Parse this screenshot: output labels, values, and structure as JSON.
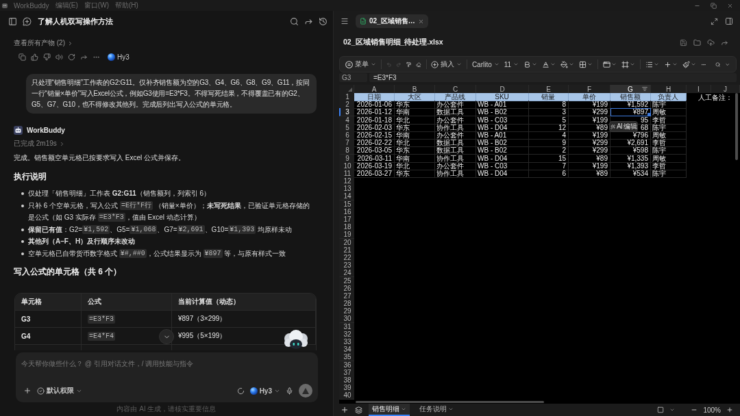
{
  "menu_bar": {
    "app_name": "WorkBuddy",
    "menus": [
      "编辑(E)",
      "窗口(W)",
      "帮助(H)"
    ]
  },
  "chat": {
    "title": "了解人机双写操作方法",
    "artifacts_link": "查看所有产物 (2)",
    "model_badge": "Hy3",
    "user_message": "只处理“销售明细”工作表的G2:G11。仅补齐销售额为空的G3、G4、G6、G8、G9、G11，按同一行“销量×单价”写入Excel公式，例如G3使用=E3*F3。不得写死结果，不得覆盖已有的G2、G5、G7、G10，也不得修改其他列。完成后列出写入公式的单元格。",
    "assistant_name": "WorkBuddy",
    "status": "已完成 2m19s",
    "summary": "完成。销售额空单元格已按要求写入 Excel 公式并保存。",
    "instructions": {
      "heading": "执行说明",
      "bullets": [
        {
          "bold": false,
          "parts": [
            {
              "kind": "text",
              "text": "仅处理「销售明细」工作表 **G2:G11**（销售额列，列索引 6）"
            }
          ]
        },
        {
          "bold": false,
          "parts": [
            {
              "kind": "text",
              "text": "只补 6 个空单元格，写入公式 "
            },
            {
              "kind": "code",
              "text": "=E行*F行"
            },
            {
              "kind": "text",
              "text": " （销量×单价）；**未写死结果**，已验证单元格存储的是公式（如 G3 实际存 "
            },
            {
              "kind": "code",
              "text": "=E3*F3"
            },
            {
              "kind": "text",
              "text": "，值由 Excel 动态计算）"
            }
          ]
        },
        {
          "bold": false,
          "parts": [
            {
              "kind": "text",
              "text": "**保留已有值**：G2="
            },
            {
              "kind": "code",
              "text": "¥1,592"
            },
            {
              "kind": "text",
              "text": "、G5="
            },
            {
              "kind": "code",
              "text": "¥1,068"
            },
            {
              "kind": "text",
              "text": "、G7="
            },
            {
              "kind": "code",
              "text": "¥2,691"
            },
            {
              "kind": "text",
              "text": "、G10="
            },
            {
              "kind": "code",
              "text": "¥1,393"
            },
            {
              "kind": "text",
              "text": " 均原样未动"
            }
          ]
        },
        {
          "bold": true,
          "parts": [
            {
              "kind": "text",
              "text": "其他列（A–F、H）及行顺序未改动"
            }
          ]
        },
        {
          "bold": false,
          "parts": [
            {
              "kind": "text",
              "text": "空单元格已自带货币数字格式 "
            },
            {
              "kind": "code",
              "text": "¥#,##0"
            },
            {
              "kind": "text",
              "text": "，公式结果显示为 "
            },
            {
              "kind": "code",
              "text": "¥897"
            },
            {
              "kind": "text",
              "text": " 等，与原有样式一致"
            }
          ]
        }
      ]
    },
    "formula_cells": {
      "heading": "写入公式的单元格（共 6 个）",
      "columns": [
        {
          "label": "单元格",
          "kind": "label"
        },
        {
          "label": "公式",
          "kind": "code"
        },
        {
          "label": "当前计算值（动态）",
          "kind": "text"
        }
      ],
      "rows": [
        {
          "cells": [
            "G3",
            "=E3*F3",
            "¥897（3×299）"
          ]
        },
        {
          "cells": [
            "G4",
            "=E4*F4",
            "¥995（5×199）"
          ]
        }
      ]
    },
    "composer": {
      "placeholder": "今天帮你做些什么？ @ 引用对话文件，/ 调用技能与指令",
      "permission": "默认权限",
      "model": "Hy3"
    },
    "footer": "内容由 AI 生成，请核实重要信息"
  },
  "editor": {
    "tab": "02_区域销售…",
    "file_name": "02_区域销售明细_待处理.xlsx",
    "toolbar": {
      "menu": "菜单",
      "insert": "插入",
      "font": "Carlito",
      "font_size": "11",
      "undo_disabled": true,
      "redo_disabled": true
    },
    "name_box": "G3",
    "formula": "=E3*F3",
    "columns": [
      {
        "label": "A",
        "kind": "number",
        "selected": false
      },
      {
        "label": "B",
        "kind": "text",
        "selected": false
      },
      {
        "label": "C",
        "kind": "text",
        "selected": false
      },
      {
        "label": "D",
        "kind": "text",
        "selected": false
      },
      {
        "label": "E",
        "kind": "number",
        "selected": false
      },
      {
        "label": "F",
        "kind": "number",
        "selected": false
      },
      {
        "label": "G",
        "kind": "number",
        "selected": true
      },
      {
        "label": "H",
        "kind": "text",
        "selected": false
      },
      {
        "label": "I",
        "selected": false
      },
      {
        "label": "J",
        "selected": false
      }
    ],
    "rows": [
      {
        "label": "1",
        "kind": "header",
        "selected": false,
        "cells": [
          "日期",
          "大区",
          "产品线",
          "SKU",
          "销量",
          "单价",
          "销售额",
          "负责人"
        ],
        "note": "人工备注："
      },
      {
        "label": "2",
        "kind": "data",
        "selected": false,
        "cells": [
          "2026-01-06",
          "华东",
          "办公套件",
          "WB - A01",
          "8",
          "¥199",
          "¥1,592",
          "陈宇"
        ]
      },
      {
        "label": "3",
        "kind": "data",
        "selected": true,
        "cells": [
          "2026-01-12",
          "华南",
          "数据工具",
          "WB - B02",
          "3",
          "¥299",
          "¥897",
          "周敏"
        ]
      },
      {
        "label": "4",
        "kind": "data",
        "selected": false,
        "cells": [
          "2026-01-18",
          "华北",
          "办公套件",
          "WB - C03",
          "5",
          "¥199",
          "95",
          "李哲"
        ]
      },
      {
        "label": "5",
        "kind": "data",
        "selected": false,
        "cells": [
          "2026-02-03",
          "华东",
          "协作工具",
          "WB - D04",
          "12",
          "¥89",
          "68",
          "陈宇"
        ]
      },
      {
        "label": "6",
        "kind": "data",
        "selected": false,
        "cells": [
          "2026-02-15",
          "华南",
          "办公套件",
          "WB - A01",
          "4",
          "¥199",
          "¥796",
          "周敏"
        ]
      },
      {
        "label": "7",
        "kind": "data",
        "selected": false,
        "cells": [
          "2026-02-22",
          "华北",
          "数据工具",
          "WB - B02",
          "9",
          "¥299",
          "¥2,691",
          "李哲"
        ]
      },
      {
        "label": "8",
        "kind": "data",
        "selected": false,
        "cells": [
          "2026-03-05",
          "华东",
          "数据工具",
          "WB - B02",
          "2",
          "¥299",
          "¥598",
          "陈宇"
        ]
      },
      {
        "label": "9",
        "kind": "data",
        "selected": false,
        "cells": [
          "2026-03-11",
          "华南",
          "协作工具",
          "WB - D04",
          "15",
          "¥89",
          "¥1,335",
          "周敏"
        ]
      },
      {
        "label": "10",
        "kind": "data",
        "selected": false,
        "cells": [
          "2026-03-19",
          "华北",
          "办公套件",
          "WB - C03",
          "7",
          "¥199",
          "¥1,393",
          "李哲"
        ]
      },
      {
        "label": "11",
        "kind": "data",
        "selected": false,
        "cells": [
          "2026-03-27",
          "华东",
          "协作工具",
          "WB - D04",
          "6",
          "¥89",
          "¥534",
          "陈宇"
        ]
      },
      {
        "label": "12",
        "kind": "empty",
        "selected": false
      },
      {
        "label": "13",
        "kind": "empty",
        "selected": false
      },
      {
        "label": "14",
        "kind": "empty",
        "selected": false
      },
      {
        "label": "15",
        "kind": "empty",
        "selected": false
      },
      {
        "label": "16",
        "kind": "empty",
        "selected": false
      },
      {
        "label": "17",
        "kind": "empty",
        "selected": false
      },
      {
        "label": "18",
        "kind": "empty",
        "selected": false
      },
      {
        "label": "19",
        "kind": "empty",
        "selected": false
      },
      {
        "label": "20",
        "kind": "empty",
        "selected": false
      },
      {
        "label": "21",
        "kind": "empty",
        "selected": false
      },
      {
        "label": "22",
        "kind": "empty",
        "selected": false
      },
      {
        "label": "23",
        "kind": "empty",
        "selected": false
      },
      {
        "label": "24",
        "kind": "empty",
        "selected": false
      },
      {
        "label": "25",
        "kind": "empty",
        "selected": false
      },
      {
        "label": "26",
        "kind": "empty",
        "selected": false
      },
      {
        "label": "27",
        "kind": "empty",
        "selected": false
      },
      {
        "label": "28",
        "kind": "empty",
        "selected": false
      },
      {
        "label": "29",
        "kind": "empty",
        "selected": false
      },
      {
        "label": "30",
        "kind": "empty",
        "selected": false
      },
      {
        "label": "31",
        "kind": "empty",
        "selected": false
      },
      {
        "label": "32",
        "kind": "empty",
        "selected": false
      },
      {
        "label": "33",
        "kind": "empty",
        "selected": false
      },
      {
        "label": "34",
        "kind": "empty",
        "selected": false
      },
      {
        "label": "35",
        "kind": "empty",
        "selected": false
      },
      {
        "label": "36",
        "kind": "empty",
        "selected": false
      },
      {
        "label": "37",
        "kind": "empty",
        "selected": false
      },
      {
        "label": "38",
        "kind": "empty",
        "selected": false
      },
      {
        "label": "39",
        "kind": "empty",
        "selected": false
      },
      {
        "label": "40",
        "kind": "empty",
        "selected": false
      }
    ],
    "ai_popup": "AI 编辑",
    "sheets": [
      {
        "label": "销售明细",
        "selected": true
      },
      {
        "label": "任务说明",
        "selected": false
      }
    ],
    "zoom": "100%"
  }
}
